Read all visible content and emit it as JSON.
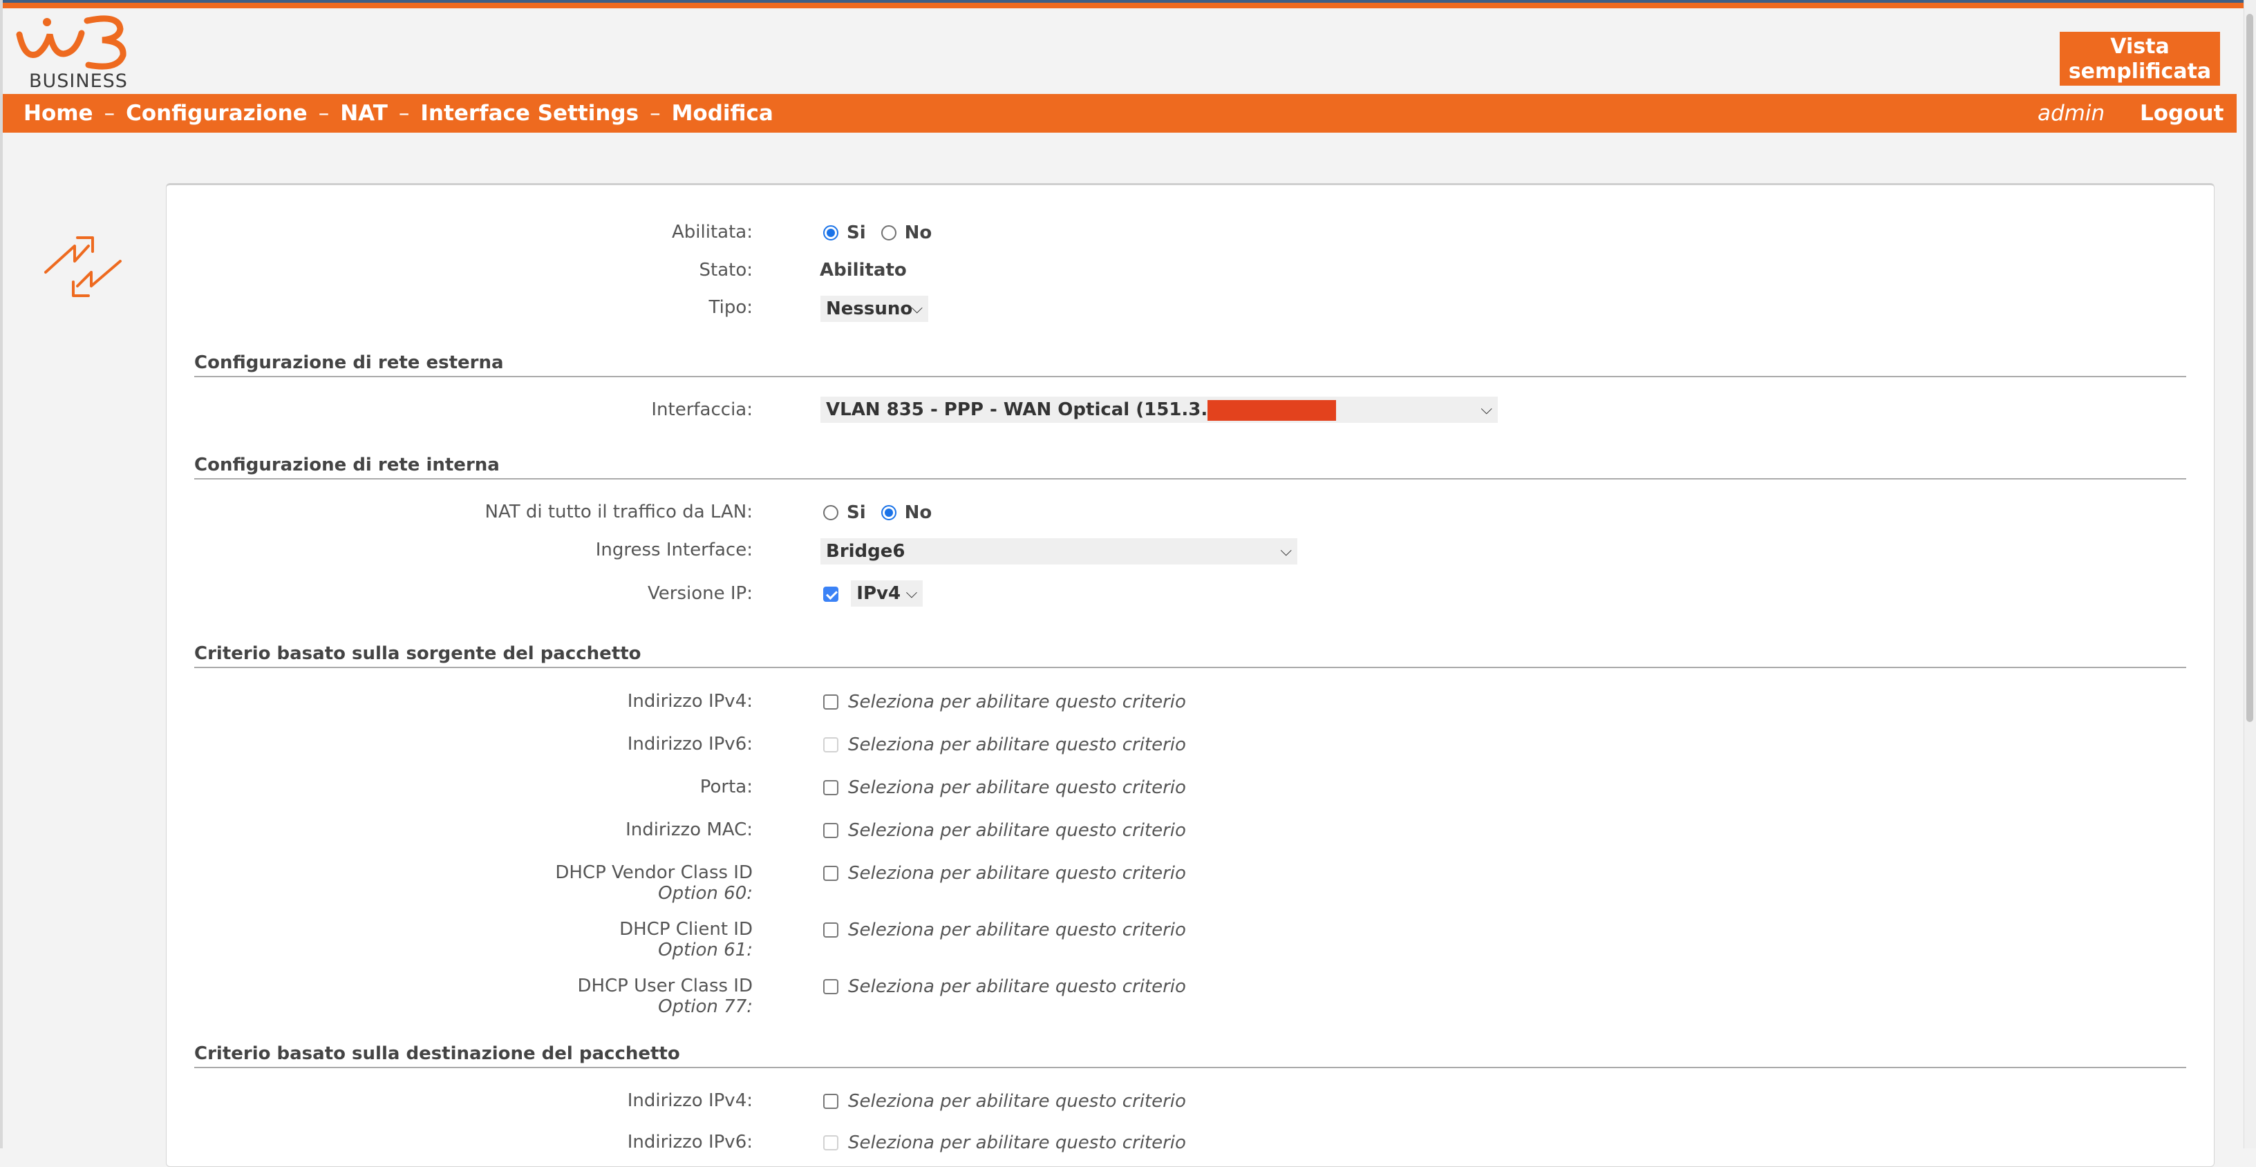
{
  "header": {
    "logo_text": "BUSINESS",
    "vista_button": "Vista semplificata",
    "breadcrumbs": [
      "Home",
      "Configurazione",
      "NAT",
      "Interface Settings",
      "Modifica"
    ],
    "user": "admin",
    "logout": "Logout"
  },
  "colors": {
    "brand_orange": "#ee6a1f",
    "link_blue": "#1a73e8",
    "redaction_red": "#e3421d"
  },
  "general": {
    "abilitata": {
      "label": "Abilitata:",
      "options": [
        "Si",
        "No"
      ],
      "selected": "Si"
    },
    "stato": {
      "label": "Stato:",
      "value": "Abilitato"
    },
    "tipo": {
      "label": "Tipo:",
      "value": "Nessuno"
    }
  },
  "external": {
    "title": "Configurazione di rete esterna",
    "interfaccia": {
      "label": "Interfaccia:",
      "value": "VLAN 835 - PPP - WAN Optical (151.3."
    }
  },
  "internal": {
    "title": "Configurazione di rete interna",
    "nat_lan": {
      "label": "NAT di tutto il traffico da LAN:",
      "options": [
        "Si",
        "No"
      ],
      "selected": "No"
    },
    "ingress": {
      "label": "Ingress Interface:",
      "value": "Bridge6"
    },
    "versione": {
      "label": "Versione IP:",
      "checked": true,
      "value": "IPv4"
    }
  },
  "source": {
    "title": "Criterio basato sulla sorgente del pacchetto",
    "hint": "Seleziona per abilitare questo criterio",
    "rows": [
      {
        "label": "Indirizzo IPv4:",
        "sub": ""
      },
      {
        "label": "Indirizzo IPv6:",
        "sub": ""
      },
      {
        "label": "Porta:",
        "sub": ""
      },
      {
        "label": "Indirizzo MAC:",
        "sub": ""
      },
      {
        "label": "DHCP Vendor Class ID",
        "sub": "Option 60:"
      },
      {
        "label": "DHCP Client ID",
        "sub": "Option 61:"
      },
      {
        "label": "DHCP User Class ID",
        "sub": "Option 77:"
      }
    ]
  },
  "destination": {
    "title": "Criterio basato sulla destinazione del pacchetto",
    "rows": [
      {
        "label": "Indirizzo IPv4:"
      },
      {
        "label": "Indirizzo IPv6:"
      }
    ]
  }
}
